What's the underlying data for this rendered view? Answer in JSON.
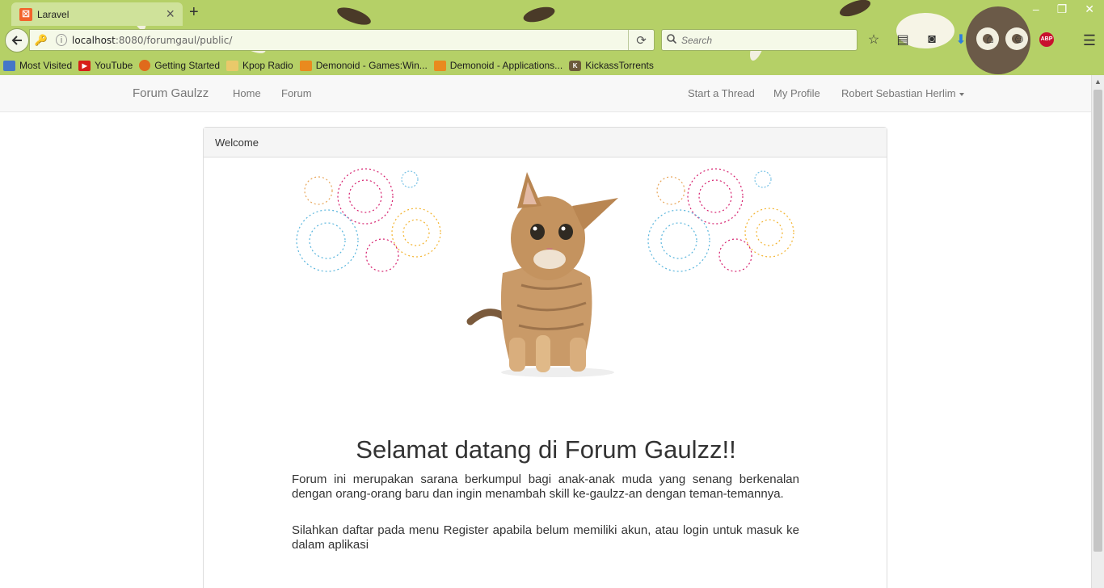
{
  "browser": {
    "tab_title": "Laravel",
    "url_host": "localhost",
    "url_rest": ":8080/forumgaul/public/",
    "search_placeholder": "Search",
    "bookmarks": [
      {
        "label": "Most Visited",
        "icon": "most-visited-icon"
      },
      {
        "label": "YouTube",
        "icon": "youtube-icon"
      },
      {
        "label": "Getting Started",
        "icon": "firefox-icon"
      },
      {
        "label": "Kpop Radio",
        "icon": "folder-icon"
      },
      {
        "label": "Demonoid - Games:Win...",
        "icon": "rss-icon"
      },
      {
        "label": "Demonoid - Applications...",
        "icon": "rss-icon"
      },
      {
        "label": "KickassTorrents",
        "icon": "kickass-icon"
      }
    ]
  },
  "site": {
    "brand": "Forum Gaulzz",
    "nav_left": [
      "Home",
      "Forum"
    ],
    "nav_right": {
      "start_thread": "Start a Thread",
      "my_profile": "My Profile",
      "user_name": "Robert Sebastian Herlim"
    }
  },
  "panel": {
    "heading": "Welcome",
    "title": "Selamat datang di Forum Gaulzz!!",
    "paragraph_1": "Forum ini merupakan sarana berkumpul bagi anak-anak muda yang senang berkenalan dengan orang-orang baru dan ingin menambah skill ke-gaulzz-an dengan teman-temannya.",
    "paragraph_2": "Silahkan daftar pada menu Register apabila belum memiliki akun, atau login untuk masuk ke dalam aplikasi"
  },
  "colors": {
    "chrome_green": "#b5d067",
    "navbar_bg": "#f8f8f8",
    "panel_heading_bg": "#f5f5f5"
  }
}
